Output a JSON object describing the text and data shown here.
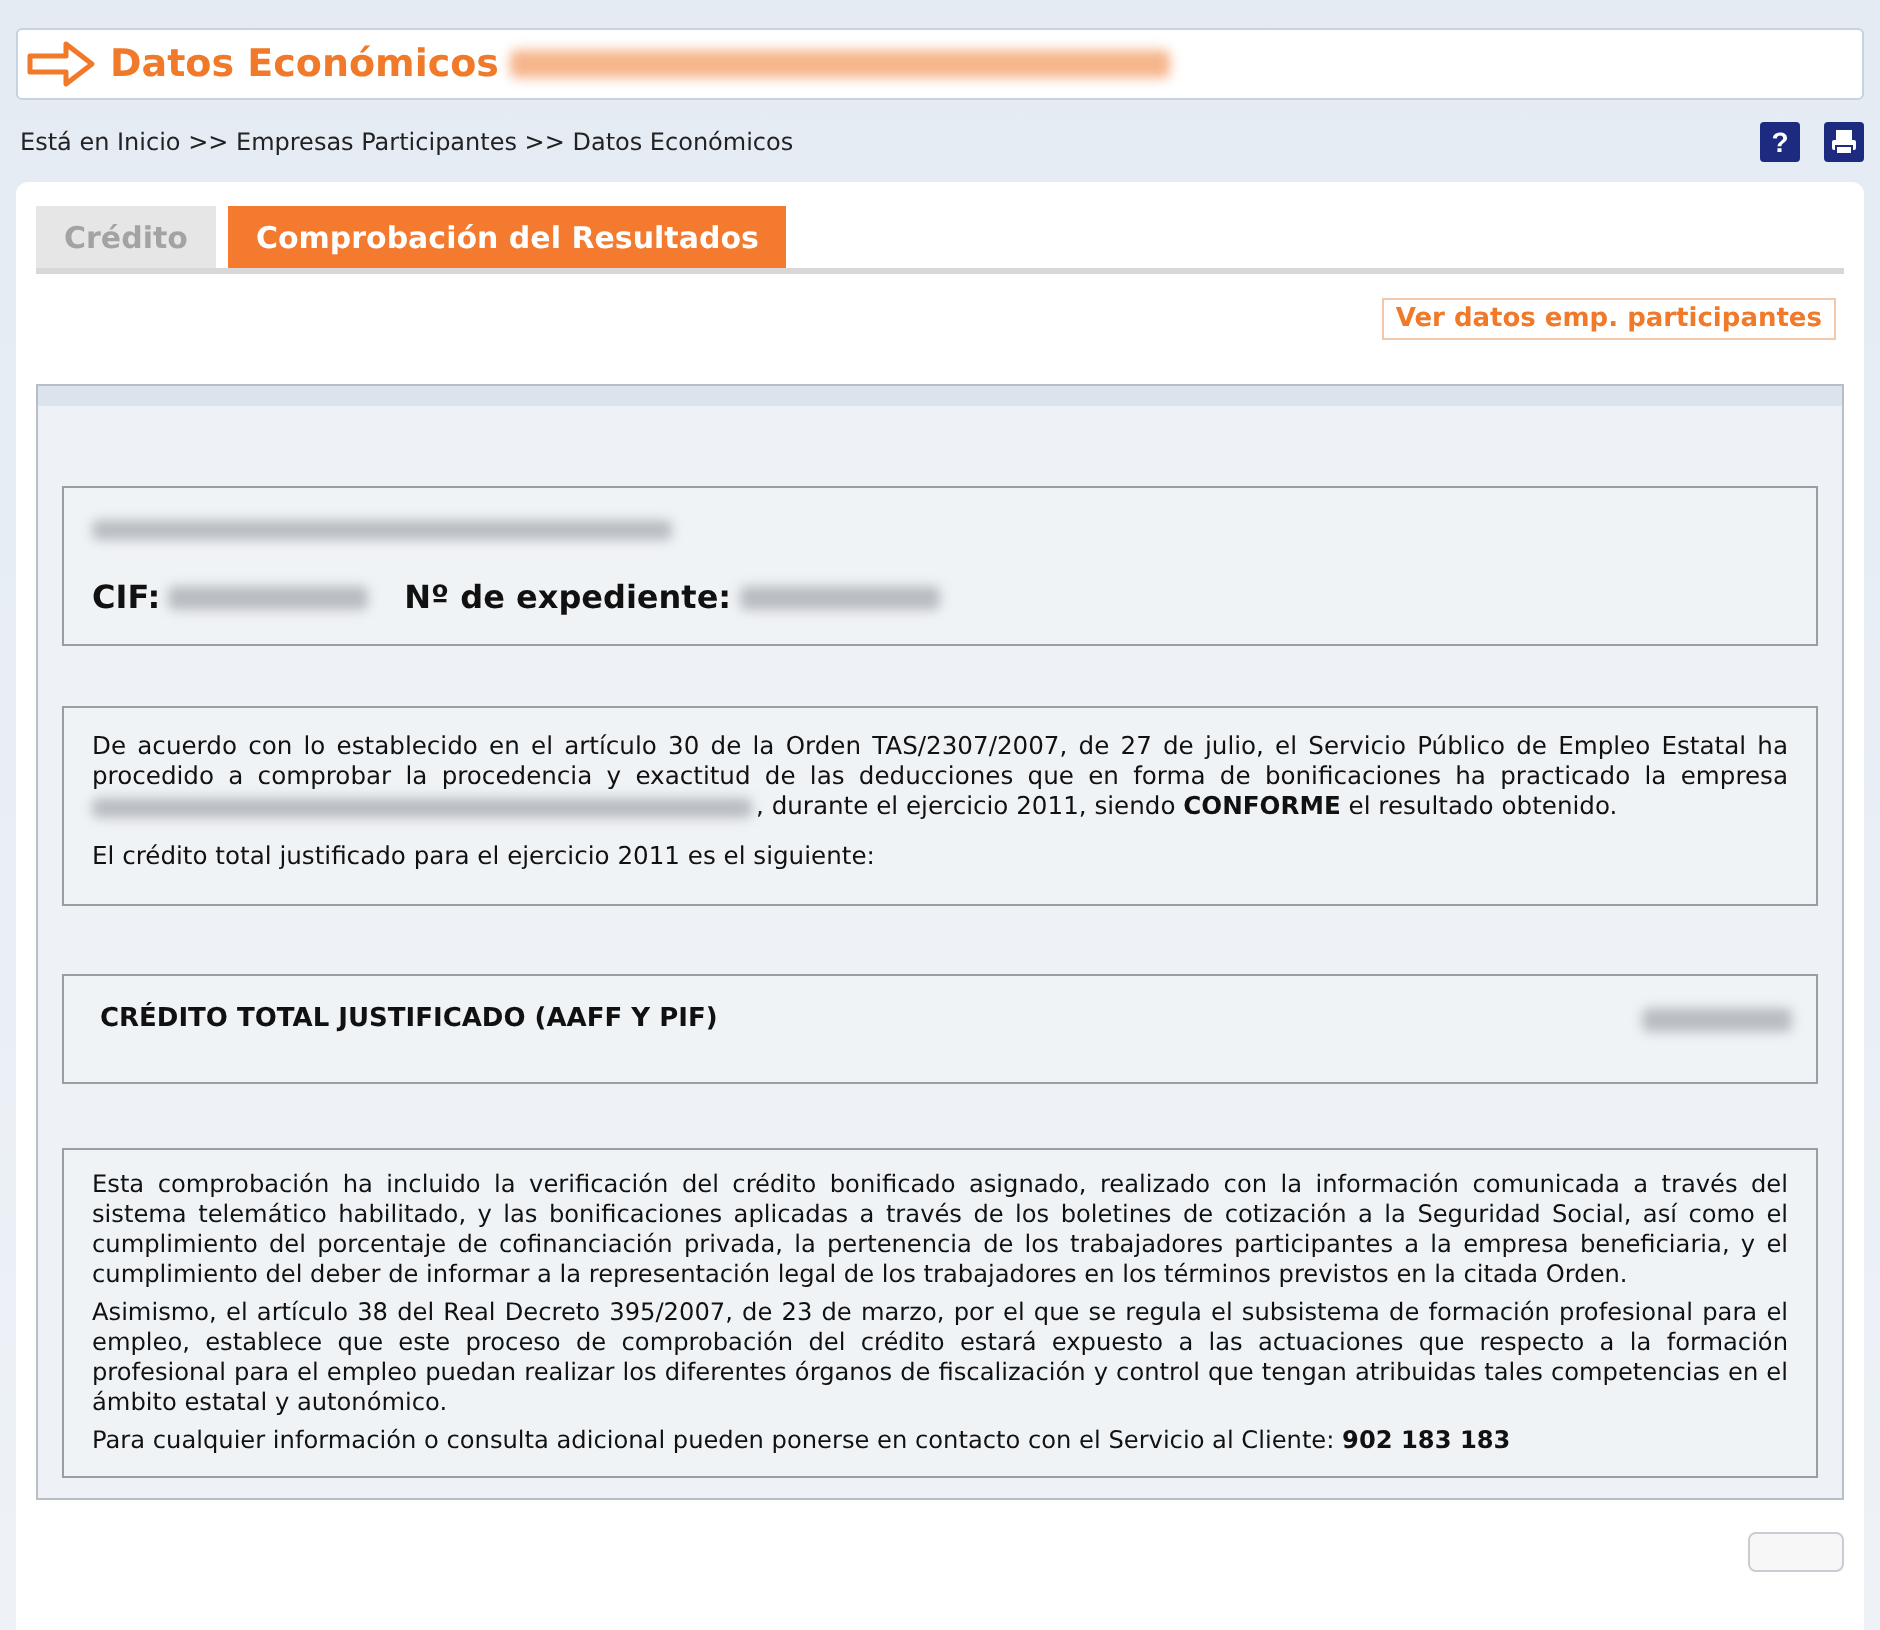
{
  "header": {
    "title": "Datos Económicos",
    "subtitle_redacted": true
  },
  "breadcrumb": "Está en Inicio >> Empresas Participantes >> Datos Económicos",
  "toolbar": [
    {
      "kind": "help",
      "label": "?"
    },
    {
      "kind": "print"
    }
  ],
  "tabs": [
    {
      "label": "Crédito",
      "selected": false
    },
    {
      "label": "Comprobación del Resultados",
      "selected": true
    }
  ],
  "action_button": "Ver datos emp. participantes",
  "company": {
    "name_redacted": true,
    "cif_label": "CIF:",
    "cif_redacted": true,
    "expediente_label": "Nº de expediente:",
    "expediente_redacted": true
  },
  "statement": {
    "before": "De acuerdo con lo establecido en el artículo 30 de la Orden TAS/2307/2007, de 27 de julio, el Servicio Público de Empleo Estatal ha procedido a comprobar la procedencia y exactitud de las deducciones que en forma de bonificaciones ha practicado la empresa",
    "redacted": true,
    "after": ", durante el ejercicio 2011, siendo **CONFORME** el resultado obtenido.",
    "note": "El crédito total justificado para el ejercicio 2011 es el siguiente:"
  },
  "total": {
    "label": "CRÉDITO TOTAL JUSTIFICADO (AAFF Y PIF)",
    "value_redacted": true
  },
  "info_paragraphs": [
    "Esta comprobación ha incluido la verificación del crédito bonificado asignado, realizado con la información comunicada a través del sistema telemático habilitado, y las bonificaciones aplicadas a través de los boletines de cotización a la Seguridad Social, así como el cumplimiento del porcentaje de cofinanciación privada, la pertenencia de los trabajadores participantes a la empresa beneficiaria, y el cumplimiento del deber de informar a la representación legal de los trabajadores en los términos previstos en la citada Orden.",
    "Asimismo, el artículo 38 del Real Decreto 395/2007, de 23 de marzo, por el que se regula el subsistema de formación profesional para el empleo, establece que este proceso de comprobación del crédito estará expuesto a las actuaciones que respecto a la formación profesional para el empleo puedan realizar los diferentes órganos de fiscalización y control que tengan atribuidas tales competencias en el ámbito estatal y autonómico.",
    "Para cualquier información o consulta adicional pueden ponerse en contacto con el Servicio al Cliente: **902 183 183**"
  ],
  "footer_button_cut": true
}
